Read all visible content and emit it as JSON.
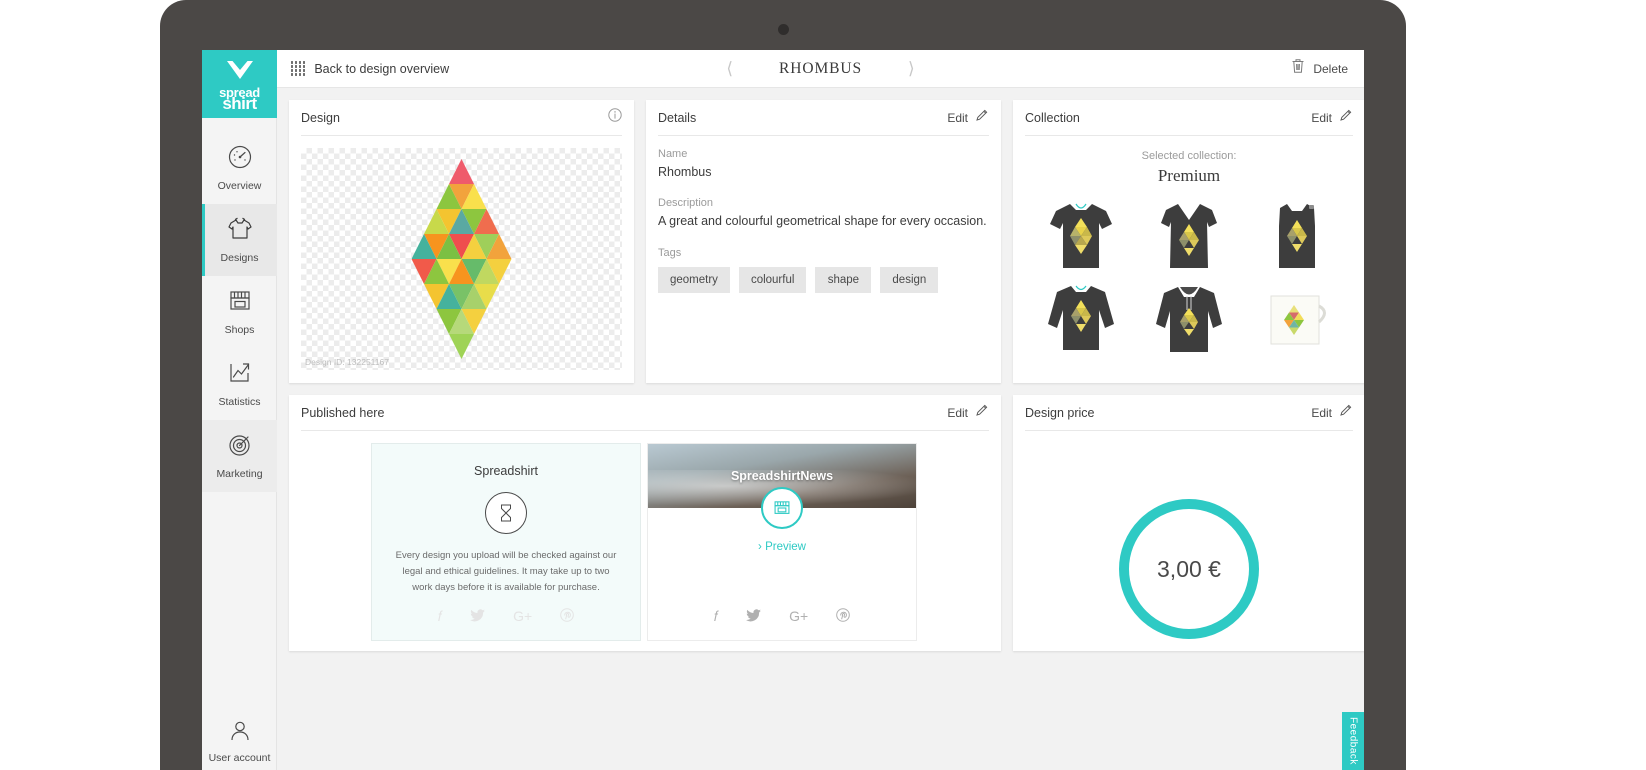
{
  "sidebar": {
    "logo": {
      "line1": "spread",
      "line2": "shirt",
      "icon": "heart-icon",
      "brand_color": "#2ecac4"
    },
    "items": [
      {
        "label": "Overview",
        "icon": "speedometer-icon",
        "active": false
      },
      {
        "label": "Designs",
        "icon": "tshirt-icon",
        "active": true
      },
      {
        "label": "Shops",
        "icon": "storefront-icon",
        "active": false
      },
      {
        "label": "Statistics",
        "icon": "chart-arrow-icon",
        "active": false
      },
      {
        "label": "Marketing",
        "icon": "target-icon",
        "active": false
      }
    ],
    "user_account": {
      "label": "User account",
      "icon": "person-icon"
    }
  },
  "topbar": {
    "back_label": "Back to design overview",
    "grid_icon": "grid-dots-icon",
    "title": "RHOMBUS",
    "prev_icon": "chevron-left-icon",
    "next_icon": "chevron-right-icon",
    "delete_label": "Delete",
    "delete_icon": "trash-icon"
  },
  "design_card": {
    "title": "Design",
    "info_icon": "info-icon",
    "design_id": "Design ID: 132251167"
  },
  "details_card": {
    "title": "Details",
    "edit_label": "Edit",
    "edit_icon": "pencil-icon",
    "name_label": "Name",
    "name_value": "Rhombus",
    "description_label": "Description",
    "description_value": "A great and colourful geometrical shape for every occasion.",
    "tags_label": "Tags",
    "tags": [
      "geometry",
      "colourful",
      "shape",
      "design"
    ]
  },
  "collection_card": {
    "title": "Collection",
    "edit_label": "Edit",
    "edit_icon": "pencil-icon",
    "selected_label": "Selected collection:",
    "selected_name": "Premium",
    "products": [
      {
        "name": "mens-tshirt"
      },
      {
        "name": "womens-vneck-tshirt"
      },
      {
        "name": "mens-tank-top"
      },
      {
        "name": "mens-longsleeve"
      },
      {
        "name": "hoodie"
      },
      {
        "name": "mug"
      }
    ]
  },
  "published_card": {
    "title": "Published here",
    "edit_label": "Edit",
    "edit_icon": "pencil-icon",
    "left": {
      "shop_name": "Spreadshirt",
      "status_icon": "hourglass-icon",
      "notice": "Every design you upload will be checked against our legal and ethical guidelines. It may take up to two work days before it is available for purchase.",
      "social": [
        "facebook-icon",
        "twitter-icon",
        "googleplus-icon",
        "pinterest-icon"
      ]
    },
    "right": {
      "shop_name": "SpreadshirtNews",
      "shop_icon": "storefront-icon",
      "preview_label": "Preview",
      "preview_caret": "chevron-right-icon",
      "social": [
        "facebook-icon",
        "twitter-icon",
        "googleplus-icon",
        "pinterest-icon"
      ]
    }
  },
  "price_card": {
    "title": "Design price",
    "edit_label": "Edit",
    "edit_icon": "pencil-icon",
    "price": "3,00 €",
    "ring_color": "#2ecac4"
  },
  "feedback": {
    "label": "Feedback"
  }
}
